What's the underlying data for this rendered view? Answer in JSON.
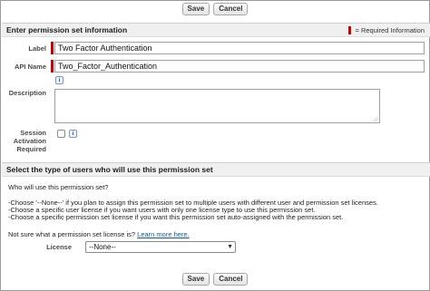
{
  "toolbar_top": {
    "save_label": "Save",
    "cancel_label": "Cancel"
  },
  "section_info": {
    "title": "Enter permission set information",
    "required_legend": "= Required Information"
  },
  "fields": {
    "label": {
      "label": "Label",
      "value": "Two Factor Authentication"
    },
    "api_name": {
      "label": "API Name",
      "value": "Two_Factor_Authentication"
    },
    "description": {
      "label": "Description",
      "value": ""
    },
    "session_activation": {
      "label_line1": "Session",
      "label_line2": "Activation",
      "label_line3": "Required",
      "checked": false
    }
  },
  "section_users": {
    "title": "Select the type of users who will use this permission set",
    "question": "Who will use this permission set?",
    "help_line1": "-Choose '--None--' if you plan to assign this permission set to multiple users with different user and permission set licenses.",
    "help_line2": "-Choose a specific user license if you want users with only one license type to use this permission set.",
    "help_line3": "-Choose a specific permission set license if you want this permission set auto-assigned with the permission set.",
    "not_sure_text": "Not sure what a permission set license is?",
    "learn_more_link": "Learn more here.",
    "license_label": "License",
    "license_selected": "--None--"
  },
  "toolbar_bottom": {
    "save_label": "Save",
    "cancel_label": "Cancel"
  },
  "icons": {
    "info": "info-icon",
    "select_arrow": "chevron-down-icon"
  },
  "colors": {
    "required": "#cc0000",
    "link": "#0b5cad",
    "section_bg": "#f0f0f0"
  }
}
